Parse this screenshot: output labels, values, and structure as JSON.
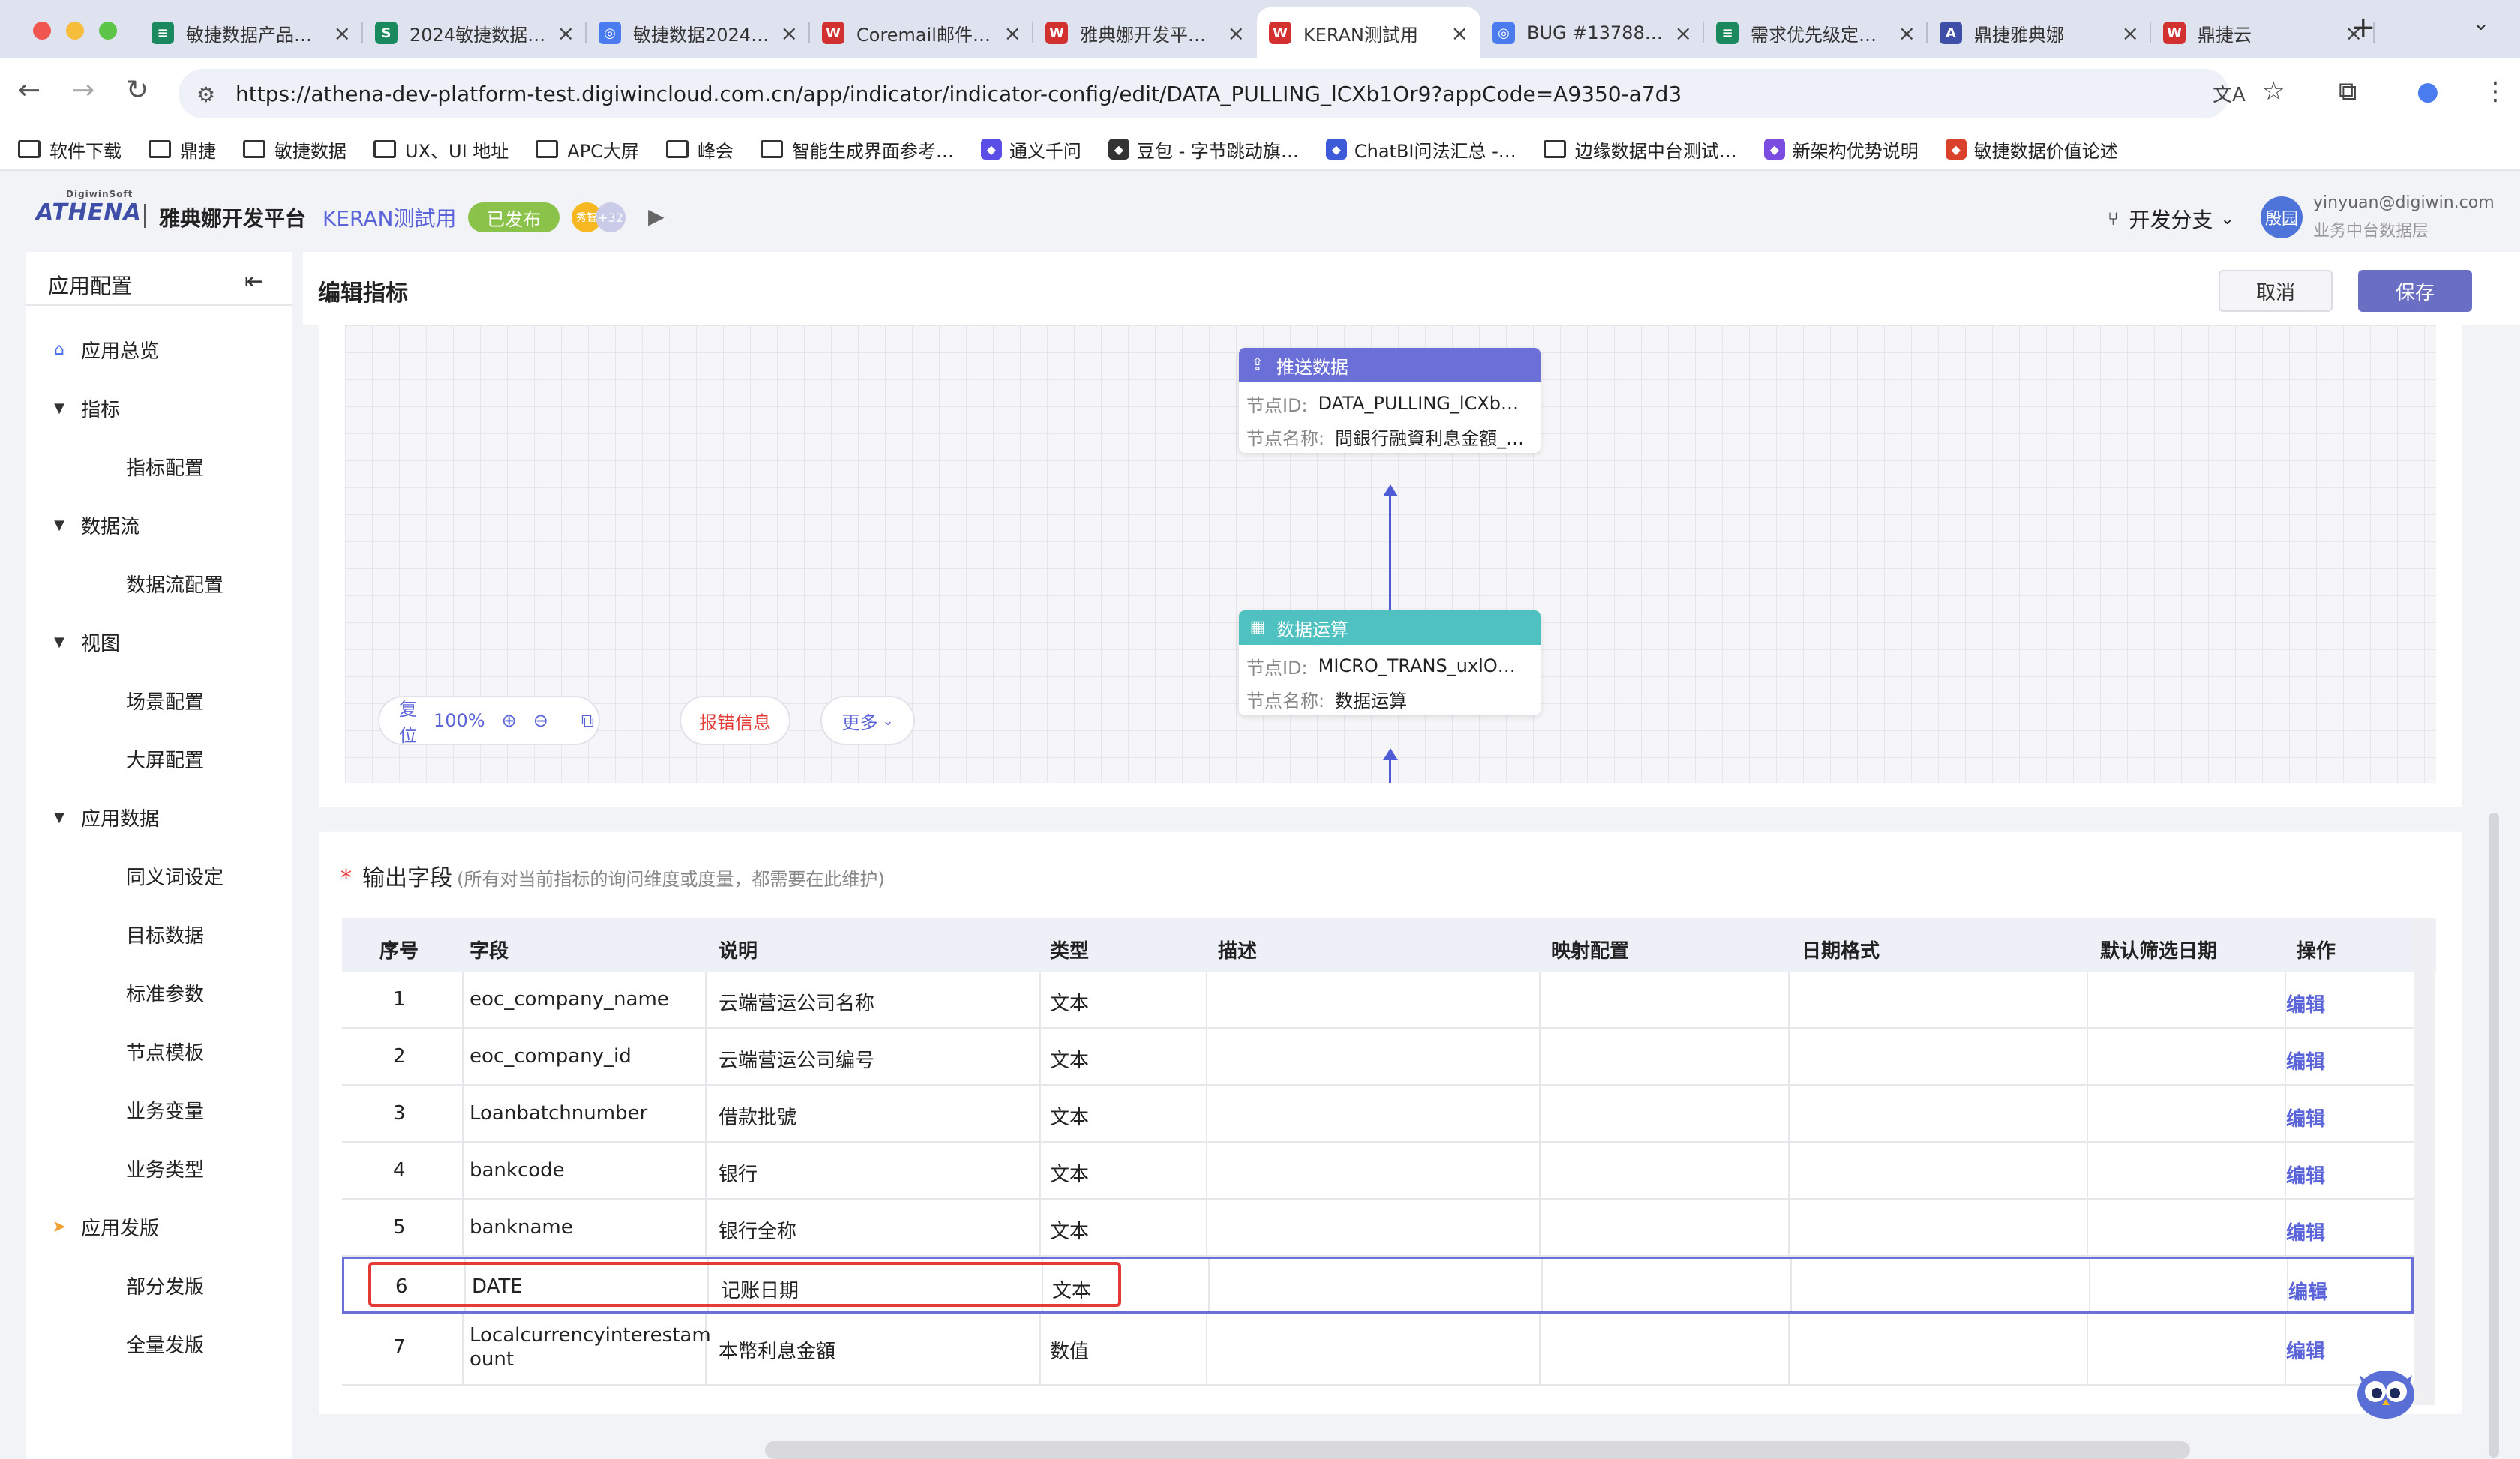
{
  "browser": {
    "tabs": [
      {
        "title": "敏捷数据产品…",
        "color": "#1a8a5e",
        "glyph": "≡"
      },
      {
        "title": "2024敏捷数据…",
        "color": "#1a8a5e",
        "glyph": "S"
      },
      {
        "title": "敏捷数据2024…",
        "color": "#4a7cf0",
        "glyph": "◎"
      },
      {
        "title": "Coremail邮件…",
        "color": "#d33030",
        "glyph": "W"
      },
      {
        "title": "雅典娜开发平…",
        "color": "#d33030",
        "glyph": "W"
      },
      {
        "title": "KERAN测試用",
        "color": "#d33030",
        "glyph": "W"
      },
      {
        "title": "BUG #13788…",
        "color": "#4a7cf0",
        "glyph": "◎"
      },
      {
        "title": "需求优先级定…",
        "color": "#1a8a5e",
        "glyph": "≡"
      },
      {
        "title": "鼎捷雅典娜",
        "color": "#3f4fa8",
        "glyph": "A"
      },
      {
        "title": "鼎捷云",
        "color": "#d33030",
        "glyph": "W"
      }
    ],
    "active_tab": 5,
    "url": "https://athena-dev-platform-test.digiwincloud.com.cn/app/indicator/indicator-config/edit/DATA_PULLING_lCXb1Or9?appCode=A9350-a7d3",
    "bookmarks": [
      {
        "label": "软件下载",
        "type": "folder"
      },
      {
        "label": "鼎捷",
        "type": "folder"
      },
      {
        "label": "敏捷数据",
        "type": "folder"
      },
      {
        "label": "UX、UI 地址",
        "type": "folder"
      },
      {
        "label": "APC大屏",
        "type": "folder"
      },
      {
        "label": "峰会",
        "type": "folder"
      },
      {
        "label": "智能生成界面参考…",
        "type": "folder"
      },
      {
        "label": "通义千问",
        "type": "site",
        "color": "#5b4ee6"
      },
      {
        "label": "豆包 - 字节跳动旗…",
        "type": "site",
        "color": "#333"
      },
      {
        "label": "ChatBI问法汇总 -…",
        "type": "site",
        "color": "#3d5bd9"
      },
      {
        "label": "边缘数据中台测试…",
        "type": "folder"
      },
      {
        "label": "新架构优势说明",
        "type": "site",
        "color": "#7a4ce0"
      },
      {
        "label": "敏捷数据价值论述",
        "type": "site",
        "color": "#d9412b"
      }
    ]
  },
  "app": {
    "logo_text": "ATHENA",
    "logo_sub": "DigiwinSoft",
    "platform": "雅典娜开发平台",
    "app_name": "KERAN测試用",
    "status": "已发布",
    "avatar_badge_1": "秀智",
    "avatar_badge_2": "+32",
    "branch_label": "开发分支",
    "user_avatar": "殷园",
    "user_email": "yinyuan@digiwin.com",
    "user_role": "业务中台数据层"
  },
  "sidebar": {
    "title": "应用配置",
    "groups": [
      {
        "label": "应用总览",
        "icon": "home-icon",
        "children": []
      },
      {
        "label": "指标",
        "icon": "caret-down-icon",
        "children": [
          "指标配置"
        ]
      },
      {
        "label": "数据流",
        "icon": "caret-down-icon",
        "children": [
          "数据流配置"
        ]
      },
      {
        "label": "视图",
        "icon": "caret-down-icon",
        "children": [
          "场景配置",
          "大屏配置"
        ]
      },
      {
        "label": "应用数据",
        "icon": "caret-down-icon",
        "children": [
          "同义词设定",
          "目标数据",
          "标准参数",
          "节点模板",
          "业务变量",
          "业务类型"
        ]
      },
      {
        "label": "应用发版",
        "icon": "send-icon",
        "children": [
          "部分发版",
          "全量发版"
        ]
      }
    ]
  },
  "page": {
    "title": "编辑指标",
    "cancel": "取消",
    "save": "保存"
  },
  "flow": {
    "push_node": {
      "title": "推送数据",
      "id_label": "节点ID:",
      "id_value": "DATA_PULLING_lCXb…",
      "name_label": "节点名称:",
      "name_value": "問銀行融資利息金額_…"
    },
    "calc_node": {
      "title": "数据运算",
      "id_label": "节点ID:",
      "id_value": "MICRO_TRANS_uxlO…",
      "name_label": "节点名称:",
      "name_value": "数据运算"
    },
    "toolbar": {
      "reset": "复位",
      "zoom": "100%",
      "error_info": "报错信息",
      "more": "更多"
    }
  },
  "output": {
    "title": "输出字段",
    "hint": "(所有对当前指标的询问维度或度量，都需要在此维护)",
    "columns": [
      "序号",
      "字段",
      "说明",
      "类型",
      "描述",
      "映射配置",
      "日期格式",
      "默认筛选日期",
      "操作"
    ],
    "rows": [
      {
        "no": "1",
        "field": "eoc_company_name",
        "desc": "云端营运公司名称",
        "type": "文本",
        "action": "编辑"
      },
      {
        "no": "2",
        "field": "eoc_company_id",
        "desc": "云端营运公司编号",
        "type": "文本",
        "action": "编辑"
      },
      {
        "no": "3",
        "field": "Loanbatchnumber",
        "desc": "借款批號",
        "type": "文本",
        "action": "编辑"
      },
      {
        "no": "4",
        "field": "bankcode",
        "desc": "银行",
        "type": "文本",
        "action": "编辑"
      },
      {
        "no": "5",
        "field": "bankname",
        "desc": "银行全称",
        "type": "文本",
        "action": "编辑"
      },
      {
        "no": "6",
        "field": "DATE",
        "desc": "记账日期",
        "type": "文本",
        "action": "编辑"
      },
      {
        "no": "7",
        "field": "Localcurrencyinterestam",
        "field_2": "ount",
        "desc": "本幣利息金額",
        "type": "数值",
        "action": "编辑"
      }
    ]
  }
}
